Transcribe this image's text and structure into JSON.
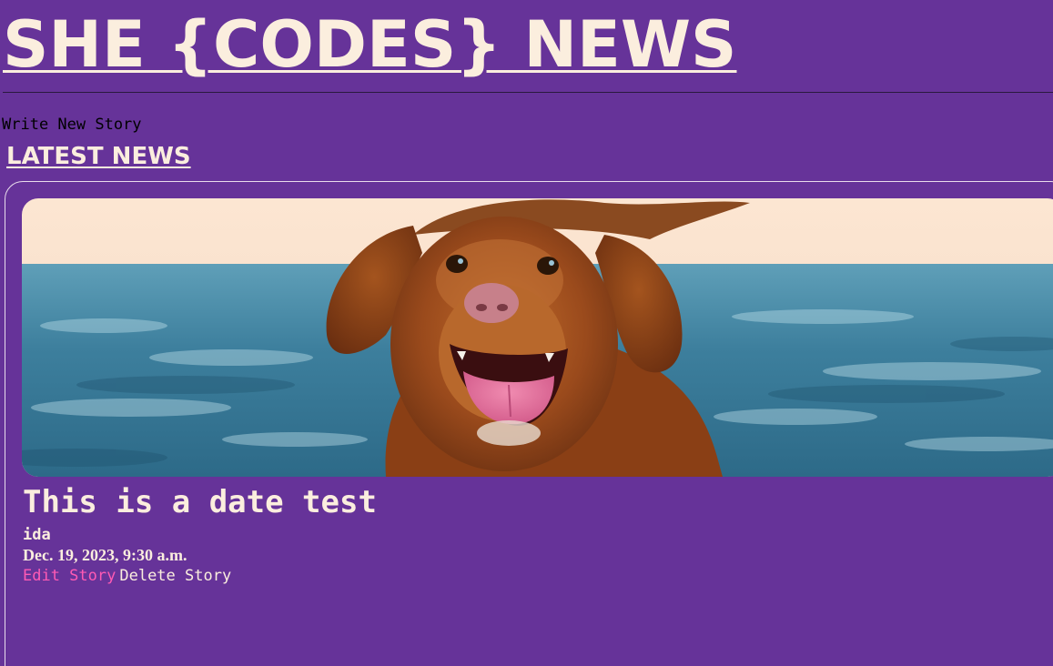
{
  "header": {
    "site_title": "SHE {CODES} NEWS"
  },
  "nav": {
    "write_new_story": "Write New Story"
  },
  "latest_news": {
    "heading": "LATEST NEWS",
    "stories": [
      {
        "title": "This is a date test",
        "author": "ida",
        "date": "Dec. 19, 2023, 9:30 a.m.",
        "edit_label": "Edit Story",
        "delete_label": "Delete Story",
        "image_subject": "dog-photo"
      }
    ]
  },
  "colors": {
    "background": "#663399",
    "text_cream": "#fbeede",
    "edit_link": "#ff5ab4",
    "nav_text": "#000000"
  }
}
